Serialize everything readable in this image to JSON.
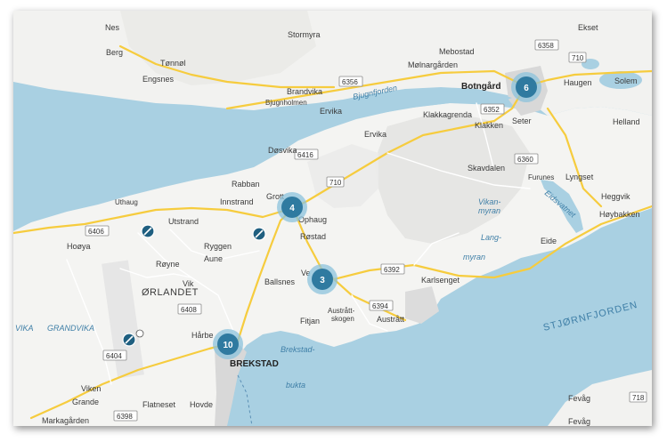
{
  "map": {
    "place_labels": [
      {
        "id": "nes",
        "text": "Nes"
      },
      {
        "id": "stormyra",
        "text": "Stormyra"
      },
      {
        "id": "berg",
        "text": "Berg"
      },
      {
        "id": "tonnol",
        "text": "Tønnøl"
      },
      {
        "id": "engsnes",
        "text": "Engsnes"
      },
      {
        "id": "mebostad",
        "text": "Mebostad"
      },
      {
        "id": "molnargarden",
        "text": "Mølnargården"
      },
      {
        "id": "brandvika",
        "text": "Brandvika"
      },
      {
        "id": "bjugnholmen",
        "text": "Bjugnholmen"
      },
      {
        "id": "ervika1",
        "text": "Ervika"
      },
      {
        "id": "ekset",
        "text": "Ekset"
      },
      {
        "id": "haugen",
        "text": "Haugen"
      },
      {
        "id": "solem",
        "text": "Solem"
      },
      {
        "id": "klakkagrenda",
        "text": "Klakkagrenda"
      },
      {
        "id": "klakken",
        "text": "Klakken"
      },
      {
        "id": "seter",
        "text": "Seter"
      },
      {
        "id": "helland",
        "text": "Helland"
      },
      {
        "id": "ervika2",
        "text": "Ervika"
      },
      {
        "id": "dosvika",
        "text": "Døsvika"
      },
      {
        "id": "skavdalen",
        "text": "Skavdalen"
      },
      {
        "id": "furunes",
        "text": "Furunes"
      },
      {
        "id": "lyngset",
        "text": "Lyngset"
      },
      {
        "id": "heggvik",
        "text": "Heggvik"
      },
      {
        "id": "hoybakken",
        "text": "Høybakken"
      },
      {
        "id": "rabban",
        "text": "Rabban"
      },
      {
        "id": "grott",
        "text": "Grott"
      },
      {
        "id": "innstrand",
        "text": "Innstrand"
      },
      {
        "id": "uthaug",
        "text": "Uthaug"
      },
      {
        "id": "utstrand",
        "text": "Utstrand"
      },
      {
        "id": "hooya",
        "text": "Hoøya"
      },
      {
        "id": "ophaug",
        "text": "Ophaug"
      },
      {
        "id": "rostad",
        "text": "Røstad"
      },
      {
        "id": "ryggen",
        "text": "Ryggen"
      },
      {
        "id": "aune",
        "text": "Aune"
      },
      {
        "id": "royne",
        "text": "Røyne"
      },
      {
        "id": "eide",
        "text": "Eide"
      },
      {
        "id": "vik",
        "text": "Vik"
      },
      {
        "id": "ballsnes",
        "text": "Ballsnes"
      },
      {
        "id": "vestre",
        "text": "Ve"
      },
      {
        "id": "karlsenget",
        "text": "Karlsenget"
      },
      {
        "id": "orlandet",
        "text": "ØRLANDET"
      },
      {
        "id": "austratt_skogen",
        "text": "Austrått-"
      },
      {
        "id": "austratt_skogen2",
        "text": "skogen"
      },
      {
        "id": "austratt",
        "text": "Austrått"
      },
      {
        "id": "fitjan",
        "text": "Fitjan"
      },
      {
        "id": "harbe",
        "text": "Hårbe"
      },
      {
        "id": "brekstad",
        "text": "BREKSTAD"
      },
      {
        "id": "viken",
        "text": "Viken"
      },
      {
        "id": "grande",
        "text": "Grande"
      },
      {
        "id": "flatneset",
        "text": "Flatneset"
      },
      {
        "id": "hovde",
        "text": "Hovde"
      },
      {
        "id": "markagarden",
        "text": "Markagården"
      },
      {
        "id": "fevag",
        "text": "Fevåg"
      },
      {
        "id": "fevag2",
        "text": "Fevåg"
      }
    ],
    "water_labels": [
      {
        "id": "bjugnfjorden",
        "text": "Bjugnfjorden"
      },
      {
        "id": "vikan_myran",
        "text": "Vikan-"
      },
      {
        "id": "vikan_myran2",
        "text": "myran"
      },
      {
        "id": "lang_myran",
        "text": "Lang-"
      },
      {
        "id": "lang_myran2",
        "text": "myran"
      },
      {
        "id": "eidsvatnet",
        "text": "Eidsvatnet"
      },
      {
        "id": "vika",
        "text": "VIKA"
      },
      {
        "id": "grandvika",
        "text": "GRANDVIKA"
      },
      {
        "id": "brekstad_bukta",
        "text": "Brekstad-"
      },
      {
        "id": "brekstad_bukta2",
        "text": "bukta"
      },
      {
        "id": "stjornfjorden",
        "text": "STJØRNFJORDEN"
      }
    ],
    "road_shields": [
      {
        "id": "r6356",
        "text": "6356"
      },
      {
        "id": "r6358",
        "text": "6358"
      },
      {
        "id": "r710a",
        "text": "710"
      },
      {
        "id": "r6352",
        "text": "6352"
      },
      {
        "id": "r6416",
        "text": "6416"
      },
      {
        "id": "r710b",
        "text": "710"
      },
      {
        "id": "r6360",
        "text": "6360"
      },
      {
        "id": "r6406",
        "text": "6406"
      },
      {
        "id": "r6392",
        "text": "6392"
      },
      {
        "id": "r6394",
        "text": "6394"
      },
      {
        "id": "r6408",
        "text": "6408"
      },
      {
        "id": "r6404",
        "text": "6404"
      },
      {
        "id": "r6398",
        "text": "6398"
      },
      {
        "id": "r718",
        "text": "718"
      }
    ],
    "clusters": [
      {
        "id": "botngard",
        "count": "6"
      },
      {
        "id": "ophaug",
        "count": "4"
      },
      {
        "id": "vestre",
        "count": "3"
      },
      {
        "id": "brekstad",
        "count": "10"
      }
    ],
    "town_bold": [
      {
        "id": "botngard",
        "text": "Botngård"
      }
    ],
    "colors": {
      "water": "#a9d0e2",
      "land": "#f4f4f2",
      "road_major": "#f6cc3e",
      "road_minor": "#ffffff",
      "cluster": "#2f7aa0",
      "cluster_halo": "#8cc3dc"
    },
    "markers": [
      {
        "id": "marker1",
        "icon": "speed-camera-icon"
      },
      {
        "id": "marker2",
        "icon": "speed-camera-icon"
      },
      {
        "id": "marker3",
        "icon": "speed-camera-icon"
      }
    ]
  }
}
